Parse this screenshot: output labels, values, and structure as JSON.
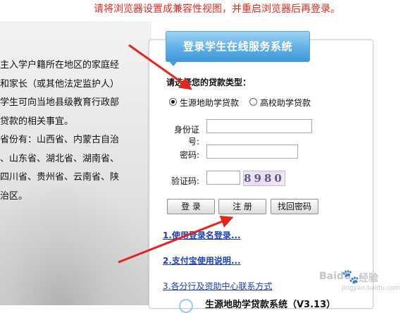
{
  "notice": "请将浏览器设置成兼容性视图，并重启浏览器后再登录。",
  "left_panel": {
    "lines": [
      "主入学户籍所在地区的家庭经",
      "和家长（或其他法定监护人）",
      "学生可向当地县级教育行政部",
      "贷款的相关事宜。",
      "省份有：山西省、内蒙古自治",
      "、山东省、湖北省、湖南省、",
      "四川省、贵州省、云南省、陕",
      "治区。"
    ]
  },
  "login": {
    "title": "登录学生在线服务系统",
    "loan_type_label": "请选择您的贷款类型：",
    "loan_types": [
      {
        "label": "生源地助学贷款",
        "selected": true
      },
      {
        "label": "高校助学贷款",
        "selected": false
      }
    ],
    "id_label": "身份证号:",
    "password_label": "密码:",
    "captcha_label": "验证码:",
    "captcha_text": "8980",
    "buttons": {
      "login": "登  录",
      "register": "注  册",
      "recover": "找回密码"
    },
    "links": [
      "1.使用登录名登录...",
      "2.支付宝使用说明...",
      "3.各分行及资助中心联系方式"
    ],
    "bottom_title": "生源地助学贷款系统（V3.13）"
  },
  "watermark": {
    "brand": "Baidu",
    "suffix": "经验",
    "url": "jingyan.baidu.com"
  },
  "colors": {
    "notice": "#e8281f",
    "title_bg": "#5fb0e6",
    "link": "#1d3fb5",
    "arrow": "#e5241b"
  }
}
